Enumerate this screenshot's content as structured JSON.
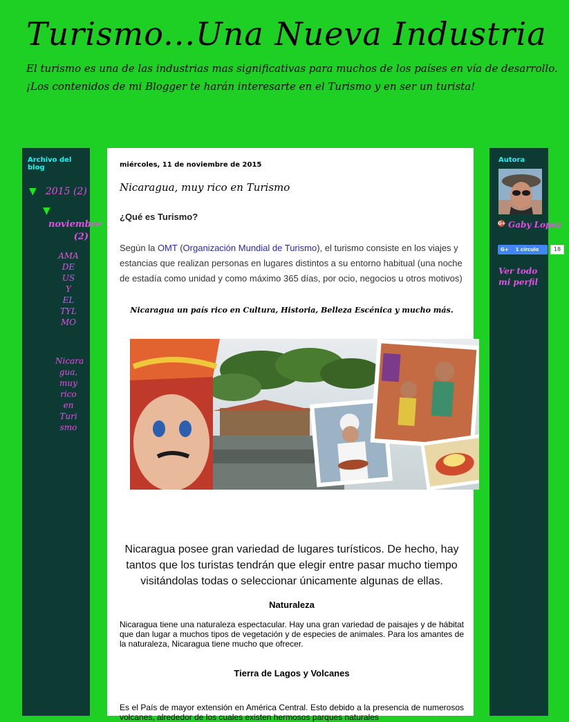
{
  "header": {
    "title": "Turismo...Una Nueva Industria",
    "description": "El turismo es una de las industrias mas significativas para muchos de los países en vía de desarrollo. ¡Los contenidos de mi Blogger te harán interesarte en el Turismo y en ser un turista!"
  },
  "sidebar_left": {
    "title": "Archivo del blog",
    "year": "2015",
    "year_count": "(2)",
    "month": "noviembre",
    "month_count": "(2)",
    "posts": [
      "AMADE US Y EL TYL MO",
      "Nicaragua, muy rico en Turismo"
    ],
    "posts_display": [
      [
        "AMA",
        "DE",
        "US",
        "Y",
        "EL",
        "TYL",
        "MO"
      ],
      [
        "Nicara",
        "gua,",
        "muy",
        "rico",
        "en",
        "Turi",
        "smo"
      ]
    ]
  },
  "post": {
    "date": "miércoles, 11 de noviembre de 2015",
    "title": "Nicaragua, muy rico en Turismo",
    "heading_que": "¿Qué es Turismo?",
    "p1_before": "Según la ",
    "p1_link1": "OMT",
    "p1_mid": " (",
    "p1_link2": "Organización Mundial de Turismo",
    "p1_after": "), el turismo consiste en los viajes y estancias que realizan personas en lugares distintos a su entorno habitual (una noche de estadía como unidad y como máximo 365 días, por ocio, negocios u otros motivos)",
    "caption": "Nicaragua un país rico en Cultura, Historia, Belleza Escénica y mucho más.",
    "big_para": "Nicaragua posee gran variedad de lugares turísticos. De hecho, hay tantos que los turistas tendrán que elegir entre pasar mucho tiempo visitándolas todas o seleccionar únicamente algunas de ellas.",
    "h_naturaleza": "Naturaleza",
    "p_naturaleza": "Nicaragua tiene una naturaleza espectacular. Hay una gran variedad de paisajes y de hábitat que dan lugar a muchos tipos de vegetación y de especies de animales. Para los amantes de la naturaleza, Nicaragua tiene mucho que ofrecer.",
    "h_tierra": "Tierra de Lagos y Volcanes",
    "p_tierra": "Es el País de mayor extensión en América Central. Esto debido a la presencia de numerosos volcanes, alrededor de los cuales existen hermosos parques naturales"
  },
  "sidebar_right": {
    "title": "Autora",
    "author": "Gaby Lopez",
    "follow_label": "1 círculo",
    "follow_count": "18",
    "profile_link": "Ver todo mi perfil"
  },
  "colors": {
    "page_bg": "#1ecf24",
    "sidebar_bg": "#0d3a33",
    "link_pink": "#e54fe5",
    "sidebar_heading": "#1ef1f1"
  }
}
